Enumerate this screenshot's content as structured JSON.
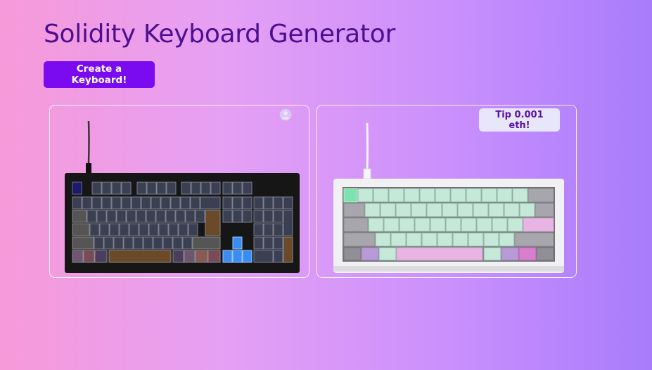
{
  "page": {
    "title": "Solidity Keyboard Generator"
  },
  "toolbar": {
    "create_label": "Create a Keyboard!"
  },
  "cards": [
    {
      "type": "keyboard-full",
      "owner_icon": "user-circle-icon",
      "case_color": "#161616",
      "key_color": "#3b3f52",
      "accent_color": "#3b8cf0"
    },
    {
      "type": "keyboard-60",
      "tip_label": "Tip 0.001 eth!",
      "case_color": "#f1f1f3",
      "key_color": "#c5e8d8",
      "accent_color": "#e7b4e3"
    }
  ]
}
